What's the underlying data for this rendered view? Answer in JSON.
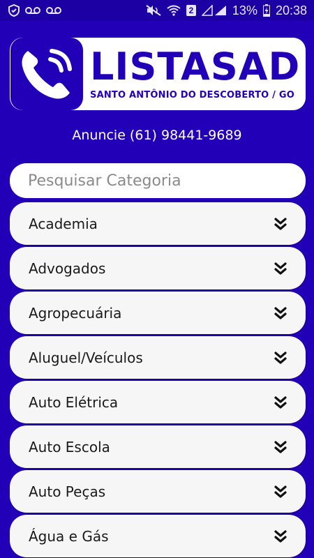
{
  "status_bar": {
    "battery_percent": "13%",
    "time": "20:38",
    "sim_slot": "2"
  },
  "logo": {
    "title": "LISTASAD",
    "subtitle": "SANTO ANTÔNIO DO DESCOBERTO / GO"
  },
  "announce": "Anuncie (61) 98441-9689",
  "search": {
    "placeholder": "Pesquisar Categoria"
  },
  "categories": [
    {
      "label": "Academia"
    },
    {
      "label": "Advogados"
    },
    {
      "label": "Agropecuária"
    },
    {
      "label": "Aluguel/Veículos"
    },
    {
      "label": "Auto Elétrica"
    },
    {
      "label": "Auto Escola"
    },
    {
      "label": "Auto Peças"
    },
    {
      "label": "Água e Gás"
    }
  ],
  "colors": {
    "brand": "#2200b8",
    "card": "#f6f6f6"
  }
}
